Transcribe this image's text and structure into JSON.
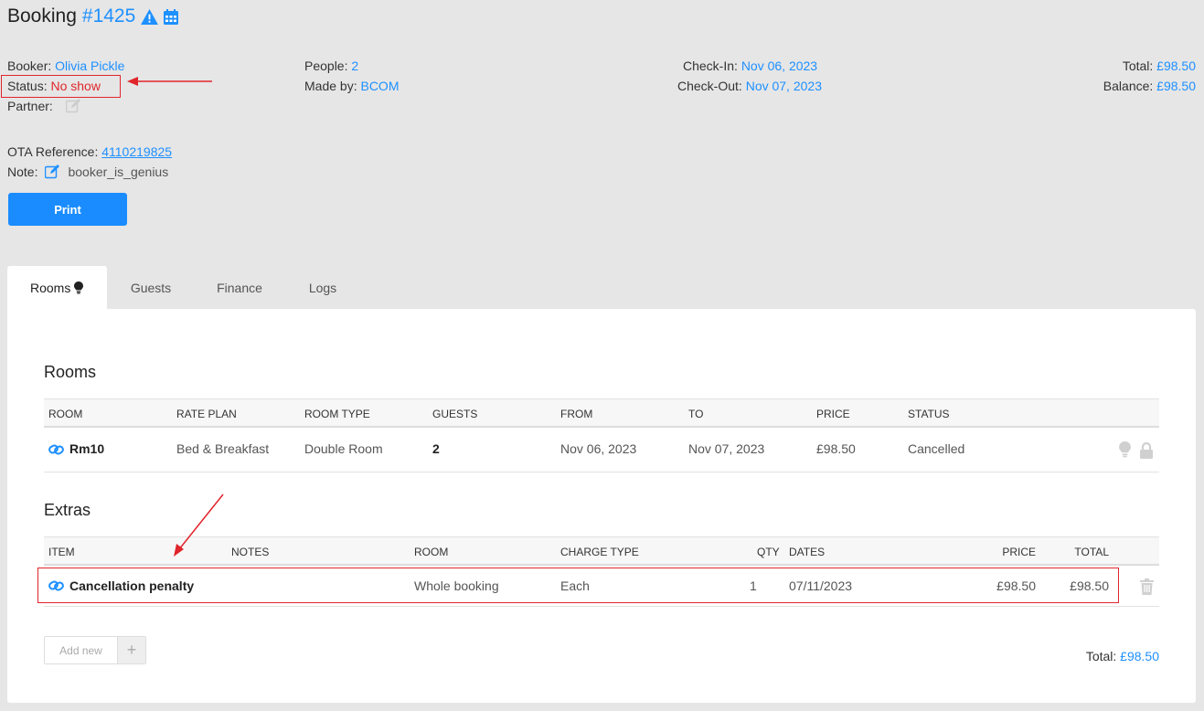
{
  "header": {
    "title_prefix": "Booking",
    "booking_number": "#1425"
  },
  "details": {
    "booker_label": "Booker:",
    "booker_value": "Olivia Pickle",
    "status_label": "Status:",
    "status_value": "No show",
    "partner_label": "Partner:",
    "people_label": "People:",
    "people_value": "2",
    "made_by_label": "Made by:",
    "made_by_value": "BCOM",
    "checkin_label": "Check-In:",
    "checkin_value": "Nov 06, 2023",
    "checkout_label": "Check-Out:",
    "checkout_value": "Nov 07, 2023",
    "total_label": "Total:",
    "total_value": "£98.50",
    "balance_label": "Balance:",
    "balance_value": "£98.50",
    "ota_label": "OTA Reference:",
    "ota_value": "4110219825",
    "note_label": "Note:",
    "note_value": "booker_is_genius"
  },
  "print_label": "Print",
  "tabs": [
    {
      "label": "Rooms"
    },
    {
      "label": "Guests"
    },
    {
      "label": "Finance"
    },
    {
      "label": "Logs"
    }
  ],
  "rooms": {
    "heading": "Rooms",
    "columns": [
      "ROOM",
      "RATE PLAN",
      "ROOM TYPE",
      "GUESTS",
      "FROM",
      "TO",
      "PRICE",
      "STATUS"
    ],
    "rows": [
      {
        "room": "Rm10",
        "rate_plan": "Bed & Breakfast",
        "room_type": "Double Room",
        "guests": "2",
        "from": "Nov 06, 2023",
        "to": "Nov 07, 2023",
        "price": "£98.50",
        "status": "Cancelled"
      }
    ]
  },
  "extras": {
    "heading": "Extras",
    "columns": [
      "ITEM",
      "NOTES",
      "ROOM",
      "CHARGE TYPE",
      "QTY",
      "DATES",
      "PRICE",
      "TOTAL"
    ],
    "rows": [
      {
        "item": "Cancellation penalty",
        "notes": "",
        "room": "Whole booking",
        "charge_type": "Each",
        "qty": "1",
        "dates": "07/11/2023",
        "price": "£98.50",
        "total": "£98.50"
      }
    ],
    "add_new_label": "Add new",
    "total_label": "Total:",
    "total_value": "£98.50"
  },
  "colors": {
    "accent": "#1e90ff",
    "status_no_show": "#e0252b",
    "annotation": "#e0252b"
  }
}
